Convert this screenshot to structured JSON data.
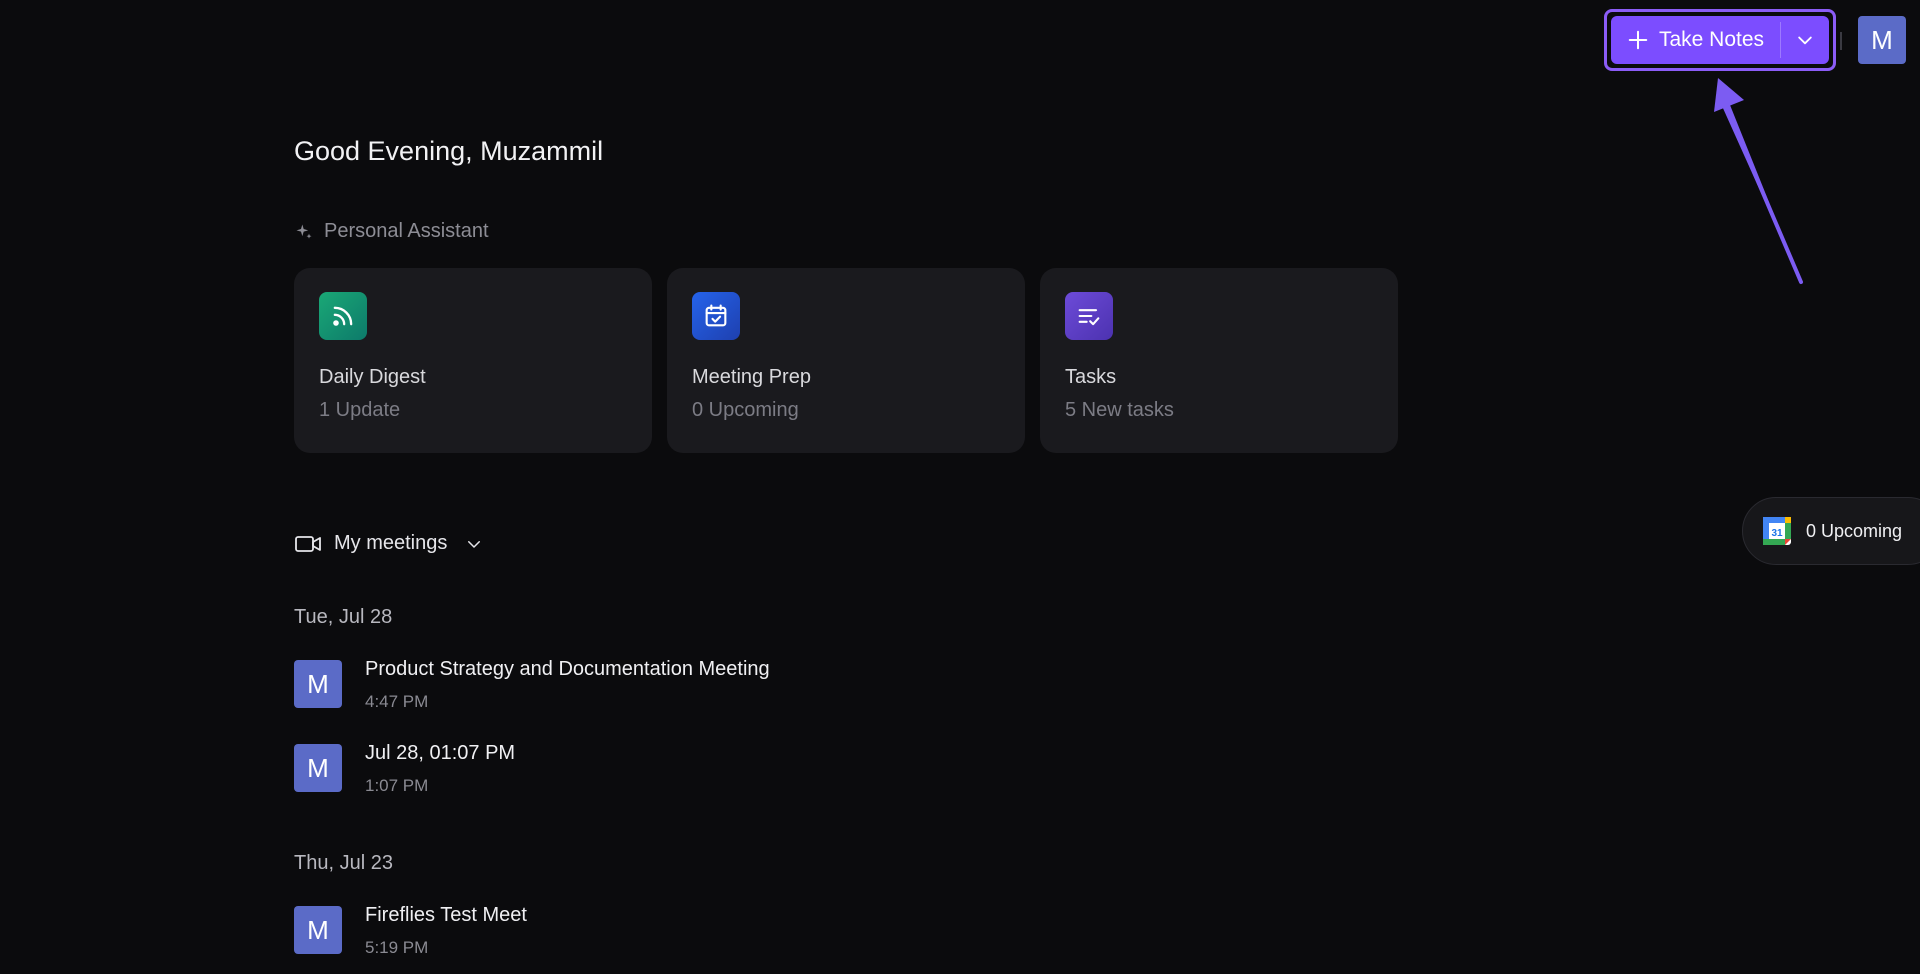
{
  "header": {
    "take_notes_label": "Take Notes",
    "avatar_initial": "M"
  },
  "greeting": "Good Evening, Muzammil",
  "assistant": {
    "label": "Personal Assistant",
    "cards": [
      {
        "title": "Daily Digest",
        "subtitle": "1 Update",
        "icon": "rss-icon",
        "color": "#1aa876"
      },
      {
        "title": "Meeting Prep",
        "subtitle": "0 Upcoming",
        "icon": "calendar-check-icon",
        "color": "#2563eb"
      },
      {
        "title": "Tasks",
        "subtitle": "5 New tasks",
        "icon": "task-list-icon",
        "color": "#6d4bd8"
      }
    ]
  },
  "meetings": {
    "header_label": "My meetings",
    "groups": [
      {
        "date": "Tue, Jul 28",
        "items": [
          {
            "avatar": "M",
            "title": "Product Strategy and Documentation Meeting",
            "time": "4:47 PM"
          },
          {
            "avatar": "M",
            "title": "Jul 28, 01:07 PM",
            "time": "1:07 PM"
          }
        ]
      },
      {
        "date": "Thu, Jul 23",
        "items": [
          {
            "avatar": "M",
            "title": "Fireflies Test Meet",
            "time": "5:19 PM"
          }
        ]
      }
    ]
  },
  "upcoming_pill": {
    "label": "0 Upcoming",
    "icon": "google-calendar-icon",
    "icon_text": "31"
  },
  "colors": {
    "accent": "#7c4dff",
    "highlight": "#8b5cf6",
    "background": "#0b0b0d",
    "card": "#1a1a1e",
    "avatar": "#5b6bc7"
  }
}
